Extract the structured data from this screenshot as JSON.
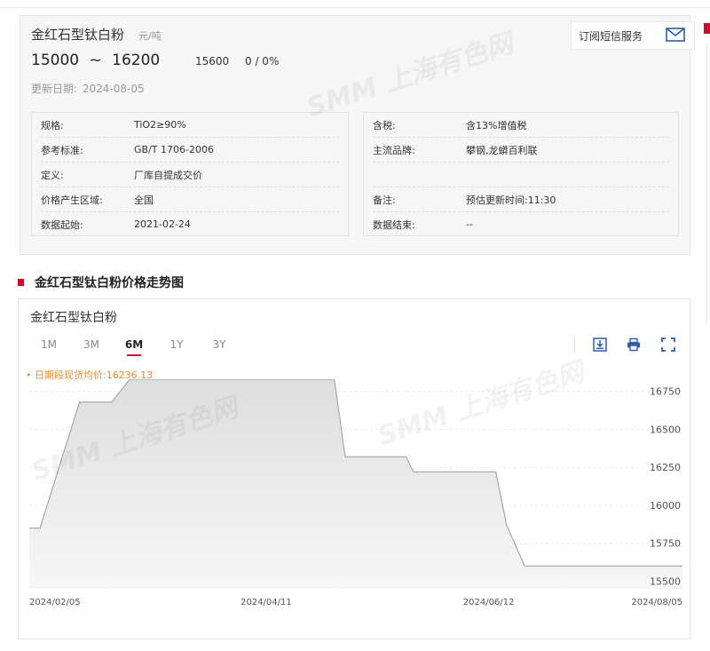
{
  "product": {
    "title": "金红石型钛白粉",
    "unit": "元/吨",
    "price_low": "15000",
    "range_sep": "~",
    "price_high": "16200",
    "avg_price": "15600",
    "change": "0 / 0%",
    "update_label": "更新日期:",
    "update_date": "2024-08-05",
    "subscribe_label": "订阅短信服务"
  },
  "specs_left": [
    {
      "key": "规格:",
      "value": "TiO2≥90%"
    },
    {
      "key": "参考标准:",
      "value": "GB/T 1706-2006"
    },
    {
      "key": "定义:",
      "value": "厂库自提成交价"
    },
    {
      "key": "价格产生区域:",
      "value": "全国"
    },
    {
      "key": "数据起始:",
      "value": "2021-02-24"
    }
  ],
  "specs_right": [
    {
      "key": "含税:",
      "value": "含13%增值税"
    },
    {
      "key": "主流品牌:",
      "value": "攀钢,龙蟒百利联"
    },
    {
      "key": "",
      "value": ""
    },
    {
      "key": "备注:",
      "value": "预估更新时间:11:30"
    },
    {
      "key": "数据结束:",
      "value": "--"
    }
  ],
  "section_title": "金红石型钛白粉价格走势图",
  "chart_card": {
    "title": "金红石型钛白粉",
    "tabs": [
      "1M",
      "3M",
      "6M",
      "1Y",
      "3Y"
    ],
    "active_tab": "6M",
    "legend": "• 日期段现货均价:16236.13",
    "icons": [
      "download-icon",
      "print-icon",
      "fullscreen-icon"
    ]
  },
  "watermarks": [
    "SMM 上海有色网"
  ],
  "chart_data": {
    "type": "area",
    "y_axis_side": "right",
    "ylim": [
      15450,
      16830
    ],
    "yticks": [
      15500,
      15750,
      16000,
      16250,
      16500,
      16750
    ],
    "xticks": [
      "2024/02/05",
      "2024/04/11",
      "2024/06/12",
      "2024/08/05"
    ],
    "x_range": [
      "2024-02-05",
      "2024-08-05"
    ],
    "x": [
      "2024-02-05",
      "2024-02-08",
      "2024-02-19",
      "2024-02-28",
      "2024-03-04",
      "2024-04-30",
      "2024-05-03",
      "2024-05-20",
      "2024-05-22",
      "2024-06-14",
      "2024-06-17",
      "2024-06-22",
      "2024-08-05"
    ],
    "y": [
      15850,
      15850,
      16680,
      16680,
      16830,
      16830,
      16320,
      16320,
      16220,
      16220,
      15870,
      15600,
      15600
    ],
    "fill_color": "#e8e8e8",
    "line_color": "#999999"
  }
}
